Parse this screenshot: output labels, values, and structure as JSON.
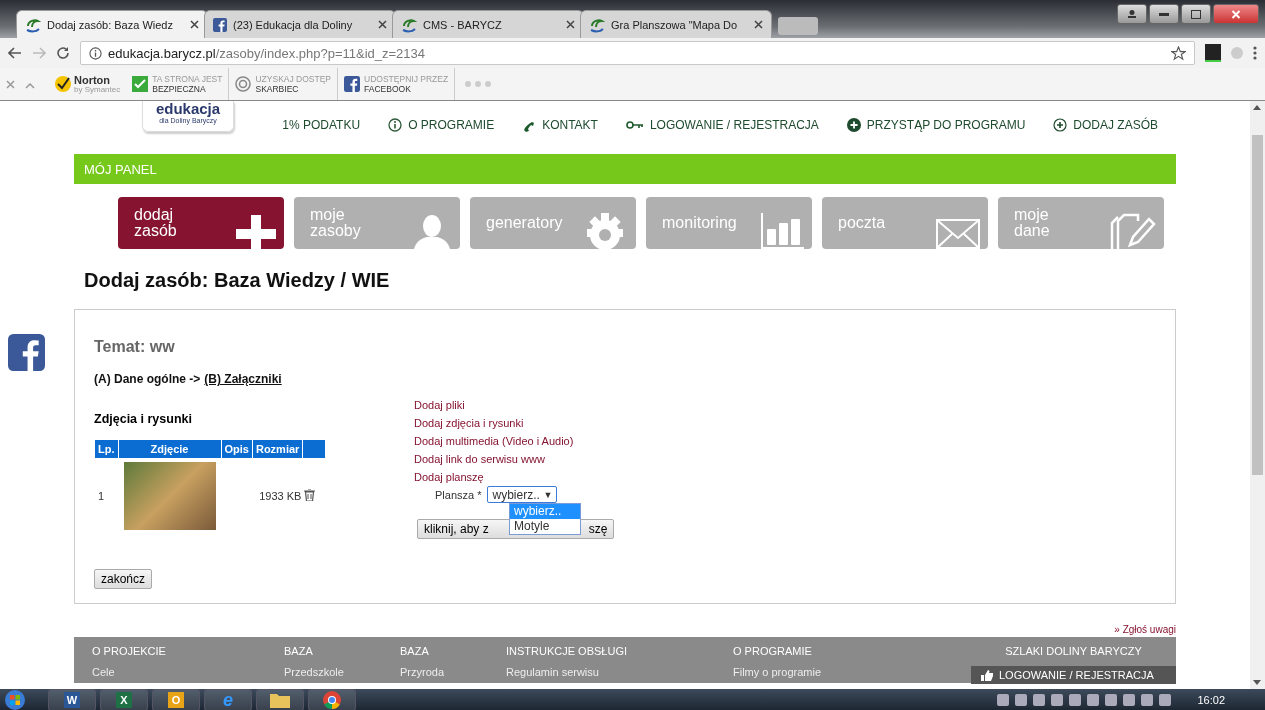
{
  "browser": {
    "tabs": [
      {
        "title": "Dodaj zasób: Baza Wiedz",
        "selected": true
      },
      {
        "title": "(23) Edukacja dla Doliny",
        "selected": false
      },
      {
        "title": "CMS - BARYCZ",
        "selected": false
      },
      {
        "title": "Gra Planszowa \"Mapa Do",
        "selected": false
      }
    ],
    "url_host": "edukacja.barycz.pl",
    "url_path": "/zasoby/index.php?p=11&id_z=2134"
  },
  "toolbar": {
    "norton": "Norton",
    "norton_sub": "by Symantec",
    "items": [
      {
        "line1": "TA STRONA JEST",
        "line2": "BEZPIECZNA"
      },
      {
        "line1": "UZYSKAJ DOSTĘP",
        "line2": "SKARBIEC"
      },
      {
        "line1": "UDOSTĘPNIJ PRZEZ",
        "line2": "FACEBOOK"
      }
    ]
  },
  "site": {
    "logo": "edukacja",
    "logo_sub": "dla Doliny Baryczy",
    "nav": [
      {
        "label": "1% PODATKU"
      },
      {
        "label": "O PROGRAMIE"
      },
      {
        "label": "KONTAKT"
      },
      {
        "label": "LOGOWANIE / REJESTRACJA"
      },
      {
        "label": "PRZYSTĄP DO PROGRAMU"
      },
      {
        "label": "DODAJ ZASÓB"
      }
    ]
  },
  "panel_title": "MÓJ PANEL",
  "tiles": [
    {
      "label": "dodaj zasób",
      "selected": true
    },
    {
      "label": "moje zasoby",
      "selected": false
    },
    {
      "label": "generatory",
      "selected": false
    },
    {
      "label": "monitoring",
      "selected": false
    },
    {
      "label": "poczta",
      "selected": false
    },
    {
      "label": "moje dane",
      "selected": false
    }
  ],
  "heading": "Dodaj zasób: Baza Wiedzy / WIE",
  "form": {
    "topic": "Temat: ww",
    "step_a": "(A) Dane ogólne ->",
    "step_b": "(B) Załączniki",
    "section": "Zdjęcia i rysunki",
    "columns": [
      "Lp.",
      "Zdjęcie",
      "Opis",
      "Rozmiar"
    ],
    "rows": [
      {
        "lp": "1",
        "size": "1933 KB"
      }
    ],
    "links": [
      "Dodaj pliki",
      "Dodaj zdjęcia i rysunki",
      "Dodaj multimedia (Video i Audio)",
      "Dodaj link do serwisu www",
      "Dodaj planszę"
    ],
    "select_label": "Plansza *",
    "select_value": "wybierz..",
    "select_arrow": "▼",
    "options": [
      {
        "label": "wybierz..",
        "selected": true
      },
      {
        "label": "Motyle",
        "selected": false
      }
    ],
    "submit_start": "kliknij, aby z",
    "submit_end": "szę",
    "finish": "zakończ"
  },
  "report": "» Zgłoś uwagi",
  "footer": [
    {
      "heading": "O PROJEKCIE",
      "item": "Cele"
    },
    {
      "heading": "BAZA",
      "item": "Przedszkole"
    },
    {
      "heading": "BAZA",
      "item": "Przyroda"
    },
    {
      "heading": "INSTRUKCJE OBSŁUGI",
      "item": "Regulamin serwisu"
    },
    {
      "heading": "O PROGRAMIE",
      "item": "Filmy o programie"
    },
    {
      "heading": "SZLAKI DOLINY BARYCZY",
      "item": "LOGOWANIE / REJESTRACJA"
    }
  ],
  "taskbar": {
    "apps": [
      "W",
      "X",
      "O",
      "e"
    ],
    "time": "16:02"
  }
}
